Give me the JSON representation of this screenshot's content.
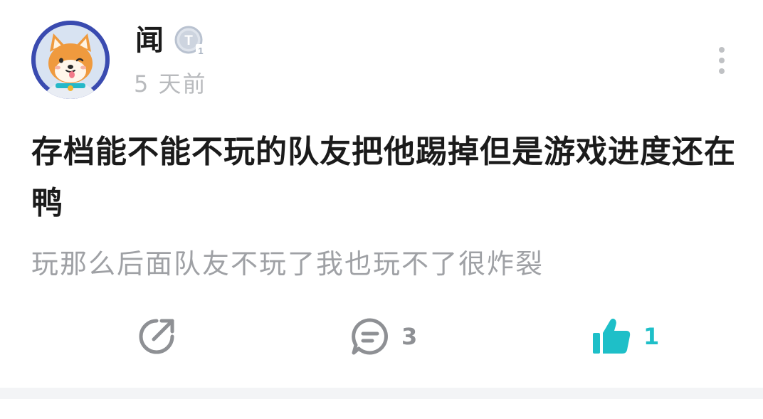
{
  "post": {
    "author": {
      "name": "闻",
      "avatar": "shiba-inu-astronaut-avatar",
      "level_badge": {
        "letter": "T",
        "level": "1"
      }
    },
    "time": "5 天前",
    "more_icon": "more-vertical-icon",
    "title": "存档能不能不玩的队友把他踢掉但是游戏进度还在鸭",
    "body": "玩那么后面队友不玩了我也玩不了很炸裂"
  },
  "actions": {
    "share": {
      "icon": "share-icon"
    },
    "comment": {
      "icon": "comment-icon",
      "count": "3"
    },
    "like": {
      "icon": "thumbs-up-icon",
      "count": "1",
      "active": true
    }
  },
  "colors": {
    "accent": "#1ebfc8",
    "muted_text": "#9fa1a5",
    "icon_gray": "#8e9094",
    "avatar_bg": "#3a4bb0"
  }
}
